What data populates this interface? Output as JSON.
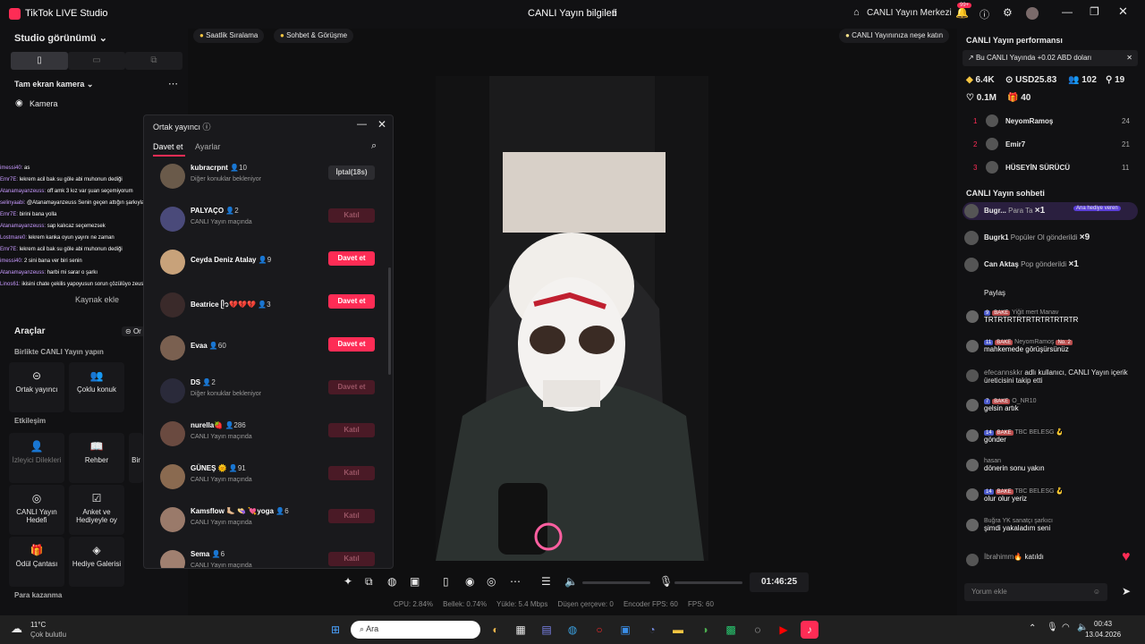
{
  "titlebar": {
    "app": "TikTok LIVE Studio",
    "page_title": "CANLI Yayın bilgileri",
    "center": "CANLI Yayın Merkezi",
    "notif": "99+"
  },
  "left": {
    "studio_view": "Studio görünümü",
    "camera_section": "Tam ekran kamera",
    "camera_item": "Kamera",
    "add_source": "Kaynak ekle",
    "tools": "Araçlar",
    "ortak_short": "Or",
    "sec_together": "Birlikte CANLI Yayın yapın",
    "sec_interaction": "Etkileşim",
    "sec_money": "Para kazanma",
    "tools_row1": [
      "Ortak yayıncı",
      "Çoklu konuk"
    ],
    "tools_row2": [
      "İzleyici Dilekleri",
      "Rehber",
      "Bir"
    ],
    "tools_row3": [
      "CANLI Yayın Hedefi",
      "Anket ve Hediyeyle oy"
    ],
    "tools_row4": [
      "Ödül Çantası",
      "Hediye Galerisi"
    ]
  },
  "overlay_chat": [
    {
      "n": "imessi40:",
      "t": "as"
    },
    {
      "n": "Emr7E:",
      "t": "lekrem acil bak su göle abi muhonun dediği"
    },
    {
      "n": "Atanamayanzeuss:",
      "t": "off amk 3 kız var şuan seçemiyorum"
    },
    {
      "n": "selinyaabi:",
      "t": "@Atanamayanzeuss Senin geçen attığın şarkıyla adam her dk moti oluyor"
    },
    {
      "n": "Emr7E:",
      "t": "birini bana yolla"
    },
    {
      "n": "Atanamayanzeuss:",
      "t": "sap kalıcaz seçemezsek"
    },
    {
      "n": "Lostmare0:",
      "t": "lekrem kanka oyun yayını ne zaman"
    },
    {
      "n": "Emr7E:",
      "t": "lekrem acil bak su göle abi muhonun dediği"
    },
    {
      "n": "imessi40:",
      "t": "2 sini bana ver biri senin"
    },
    {
      "n": "Atanamayanzeuss:",
      "t": "harbi mi sarar o şarkı"
    },
    {
      "n": "Linos61:",
      "t": "ikisini chate çekilis yapoyusun sorun çözülüyo zeusum"
    }
  ],
  "pills": {
    "ranking": "Saatlik Sıralama",
    "chat": "Sohbet & Görüşme",
    "fun": "CANLI Yayınınıza neşe katın"
  },
  "modal": {
    "title": "Ortak yayıncı",
    "tab_invite": "Davet et",
    "tab_settings": "Ayarlar",
    "rows": [
      {
        "name": "kubracrpnt",
        "count": "10",
        "status": "Diğer konuklar bekleniyor",
        "button": "İptal(18s)",
        "kind": "gray",
        "color": "#6a5a4a"
      },
      {
        "name": "PALYAÇO",
        "count": "2",
        "status": "CANLI Yayın maçında",
        "button": "Katıl",
        "kind": "dim",
        "color": "#4a4a7a"
      },
      {
        "name": "Ceyda Deniz Atalay",
        "count": "9",
        "status": "",
        "button": "Davet et",
        "kind": "red",
        "color": "#c8a27a"
      },
      {
        "name": "Beatrice ᥫ᭡💔💔💔",
        "count": "3",
        "status": "",
        "button": "Davet et",
        "kind": "red",
        "color": "#3a2a2a"
      },
      {
        "name": "Evaa",
        "count": "60",
        "status": "",
        "button": "Davet et",
        "kind": "red",
        "color": "#7a6050"
      },
      {
        "name": "DS",
        "count": "2",
        "status": "Diğer konuklar bekleniyor",
        "button": "Davet et",
        "kind": "dim",
        "color": "#2a2a3a"
      },
      {
        "name": "nurella🍓",
        "count": "286",
        "status": "CANLI Yayın maçında",
        "button": "Katıl",
        "kind": "dim",
        "color": "#6a4a40"
      },
      {
        "name": "GÜNEŞ 🌞",
        "count": "91",
        "status": "CANLI Yayın maçında",
        "button": "Katıl",
        "kind": "dim",
        "color": "#8a6a50"
      },
      {
        "name": "Kamsflow 🦶🏼 👒 💘yoga",
        "count": "6",
        "status": "CANLI Yayın maçında",
        "button": "Katıl",
        "kind": "dim",
        "color": "#9a7a6a"
      },
      {
        "name": "Sema",
        "count": "6",
        "status": "CANLI Yayın maçında",
        "button": "Katıl",
        "kind": "dim",
        "color": "#a08070"
      }
    ]
  },
  "right": {
    "perf_title": "CANLI Yayın performansı",
    "notice": "Bu CANLI Yayında +0.02 ABD doları",
    "stats": [
      "6.4K",
      "USD25.83",
      "102",
      "19",
      "0.1M",
      "40"
    ],
    "ranking": [
      {
        "r": "1",
        "n": "NeyomRamoş",
        "v": "24"
      },
      {
        "r": "2",
        "n": "Emir7",
        "v": "21"
      },
      {
        "r": "3",
        "n": "HÜSEYİN SÜRÜCÜ",
        "v": "11"
      }
    ],
    "chat_title": "CANLI Yayın sohbeti",
    "gifts": [
      {
        "n": "Bugr...",
        "t": "Para Ta",
        "x": "×1",
        "tag": "Ana hediye veren"
      },
      {
        "n": "Bugrk1",
        "t": "Popüler Ol gönderildi",
        "x": "×9"
      },
      {
        "n": "Can Aktaş",
        "t": "Pop gönderildi",
        "x": "×1"
      }
    ],
    "messages": [
      {
        "lv": "",
        "bake": "",
        "n": "",
        "t": "Paylaş"
      },
      {
        "lv": "9",
        "bake": "BAKE",
        "n": "Yiğit mert Manav",
        "t": "TRTRTRTRTRTRTRTRTRTR"
      },
      {
        "lv": "11",
        "bake": "BAKE",
        "n": "NeyomRamoş",
        "tag": "No. 2",
        "t": "mahkemede görüşürsünüz"
      },
      {
        "lv": "",
        "bake": "",
        "n": "efecannskkr",
        "t": "adlı kullanıcı, CANLI Yayın içerik üreticisini takip etti"
      },
      {
        "lv": "7",
        "bake": "BAKE",
        "n": "O_NR10",
        "t": "gelsin artık"
      },
      {
        "lv": "14",
        "bake": "BAKE",
        "n": "TBC BELESG 🪝",
        "t": "gönder"
      },
      {
        "lv": "",
        "bake": "",
        "n": "hasan",
        "t": "dönerin sonu yakın"
      },
      {
        "lv": "14",
        "bake": "BAKE",
        "n": "TBC BELESG 🪝",
        "t": "olur olur yeriz"
      },
      {
        "lv": "",
        "bake": "",
        "n": "Buğra YK sanatçı şarkıcı",
        "t": "şimdi yakaladım seni"
      },
      {
        "lv": "",
        "bake": "",
        "n": "İbrahimm🔥",
        "t": "katıldı"
      }
    ],
    "comment_placeholder": "Yorum ekle"
  },
  "timer": "01:46:25",
  "status": {
    "cpu": "CPU: 2.84%",
    "mem": "Bellek: 0.74%",
    "up": "Yükle: 5.4 Mbps",
    "drop": "Düşen çerçeve: 0",
    "enc": "Encoder FPS: 60",
    "fps": "FPS: 60"
  },
  "taskbar": {
    "temp": "11°C",
    "weather": "Çok bulutlu",
    "search": "Ara",
    "time": "00:43",
    "date": "13.04.2026"
  },
  "colors": {
    "accent": "#fe2c55",
    "panel": "#111113"
  }
}
